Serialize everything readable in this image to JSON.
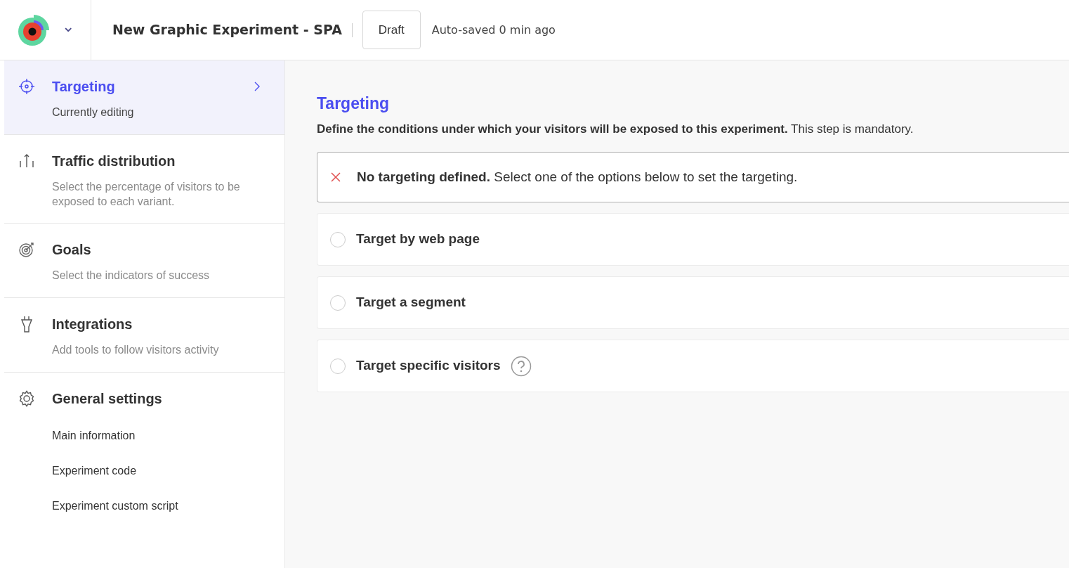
{
  "header": {
    "dropdown_icon": "⌄",
    "title": "New Graphic Experiment - SPA",
    "status": "Draft",
    "autosave": "Auto-saved 0 min ago"
  },
  "sidebar": {
    "steps": [
      {
        "title": "Targeting",
        "subtitle": "Currently editing",
        "selected": true
      },
      {
        "title": "Traffic distribution",
        "subtitle": "Select the percentage of visitors to be exposed to each variant.",
        "selected": false
      },
      {
        "title": "Goals",
        "subtitle": "Select the indicators of success",
        "selected": false
      },
      {
        "title": "Integrations",
        "subtitle": "Add tools to follow visitors activity",
        "selected": false
      },
      {
        "title": "General settings",
        "selected": false,
        "children": [
          {
            "label": "Main information"
          },
          {
            "label": "Experiment code"
          },
          {
            "label": "Experiment custom script"
          }
        ]
      }
    ]
  },
  "main": {
    "heading": "Targeting",
    "description": "**Define the conditions under which your visitors will be exposed to this experiment.** This step is mandatory.",
    "alert": "**No targeting defined.** Select one of the options below to set the targeting.",
    "options": [
      {
        "label": "Target by web page",
        "selected": false,
        "help": false
      },
      {
        "label": "Target a segment",
        "selected": false,
        "help": false
      },
      {
        "label": "Target specific visitors",
        "selected": false,
        "help": true
      }
    ]
  }
}
